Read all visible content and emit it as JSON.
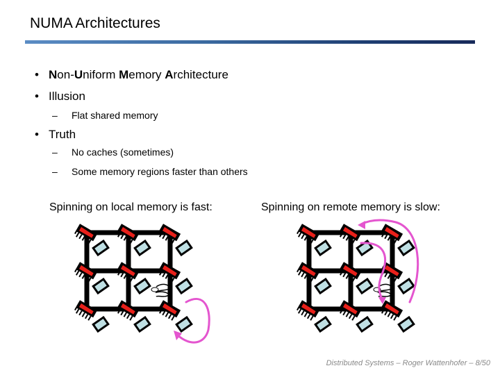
{
  "slide": {
    "title": "NUMA Architectures",
    "bullets": [
      {
        "level": 1,
        "parts": [
          {
            "text": "N",
            "bold": true
          },
          {
            "text": "on-",
            "bold": false
          },
          {
            "text": "U",
            "bold": true
          },
          {
            "text": "niform ",
            "bold": false
          },
          {
            "text": "M",
            "bold": true
          },
          {
            "text": "emory ",
            "bold": false
          },
          {
            "text": "A",
            "bold": true
          },
          {
            "text": "rchitecture",
            "bold": false
          }
        ]
      },
      {
        "level": 1,
        "text": "Illusion"
      },
      {
        "level": 2,
        "text": "Flat shared memory"
      },
      {
        "level": 1,
        "text": "Truth"
      },
      {
        "level": 2,
        "text": "No caches (sometimes)"
      },
      {
        "level": 2,
        "text": "Some memory regions faster than others"
      }
    ],
    "bullet_glyph": "•",
    "dash_glyph": "–",
    "captions": {
      "left": "Spinning on local memory is fast:",
      "right": "Spinning on remote memory is slow:"
    },
    "footer": "Distributed Systems  –  Roger Wattenhofer  – 8/50",
    "colors": {
      "processor": "#e8201a",
      "memory": "#bfe0e4",
      "arrow": "#e455cf",
      "footer": "#8a8a8a"
    },
    "diagrams": [
      {
        "name": "local-memory-grid",
        "rows": 3,
        "cols": 3,
        "spinning_node": [
          1,
          1
        ],
        "memory_accessed": "local"
      },
      {
        "name": "remote-memory-grid",
        "rows": 3,
        "cols": 3,
        "spinning_node": [
          1,
          1
        ],
        "memory_accessed": "remote"
      }
    ]
  }
}
